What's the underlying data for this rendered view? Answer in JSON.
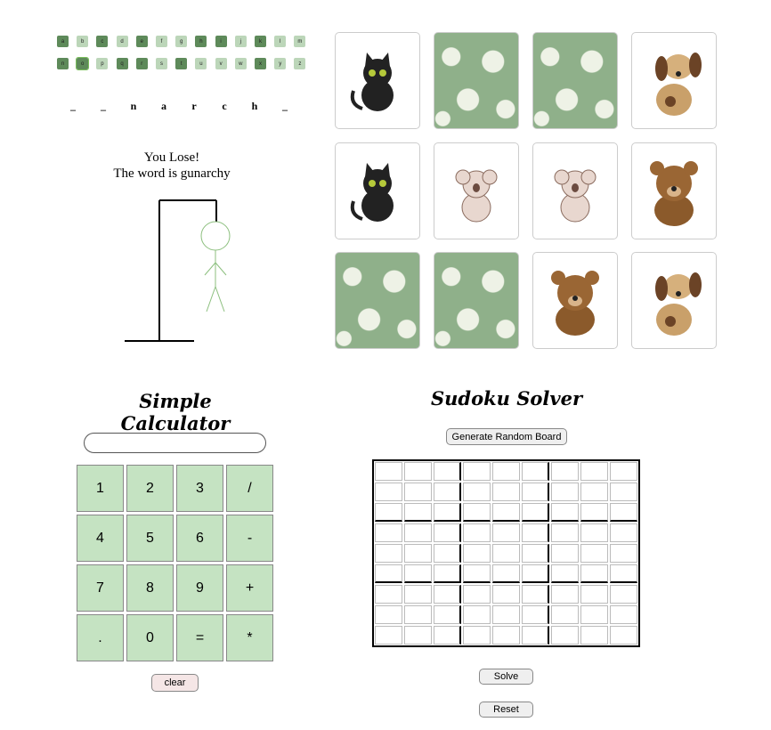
{
  "hangman": {
    "letters": [
      {
        "l": "a",
        "u": 1
      },
      {
        "l": "b",
        "u": 0
      },
      {
        "l": "c",
        "u": 1
      },
      {
        "l": "d",
        "u": 0
      },
      {
        "l": "e",
        "u": 1
      },
      {
        "l": "f",
        "u": 0
      },
      {
        "l": "g",
        "u": 0
      },
      {
        "l": "h",
        "u": 1
      },
      {
        "l": "i",
        "u": 1
      },
      {
        "l": "j",
        "u": 0
      },
      {
        "l": "k",
        "u": 1
      },
      {
        "l": "l",
        "u": 0
      },
      {
        "l": "m",
        "u": 0
      },
      {
        "l": "n",
        "u": 1
      },
      {
        "l": "o",
        "u": 1
      },
      {
        "l": "p",
        "u": 0
      },
      {
        "l": "q",
        "u": 1
      },
      {
        "l": "r",
        "u": 1
      },
      {
        "l": "s",
        "u": 0
      },
      {
        "l": "t",
        "u": 1
      },
      {
        "l": "u",
        "u": 0
      },
      {
        "l": "v",
        "u": 0
      },
      {
        "l": "w",
        "u": 0
      },
      {
        "l": "x",
        "u": 1
      },
      {
        "l": "y",
        "u": 0
      },
      {
        "l": "z",
        "u": 0
      }
    ],
    "word": [
      "_",
      "_",
      "n",
      "a",
      "r",
      "c",
      "h",
      "_"
    ],
    "result": "You Lose!",
    "reveal": "The word is gunarchy"
  },
  "memory": {
    "cards": [
      "cat",
      "flower",
      "flower",
      "dog",
      "cat",
      "koala",
      "koala",
      "bear",
      "flower",
      "flower",
      "bear",
      "dog"
    ]
  },
  "calculator": {
    "title": "Simple Calculator",
    "display": "",
    "keys": [
      "1",
      "2",
      "3",
      "/",
      "4",
      "5",
      "6",
      "-",
      "7",
      "8",
      "9",
      "+",
      ".",
      "0",
      "=",
      "*"
    ],
    "clear": "clear"
  },
  "sudoku": {
    "title": "Sudoku Solver",
    "generate": "Generate Random Board",
    "solve": "Solve",
    "reset": "Reset"
  },
  "colors": {
    "used": "#5e8a5a",
    "free": "#bcd6b9",
    "calc": "#c5e3c2"
  }
}
